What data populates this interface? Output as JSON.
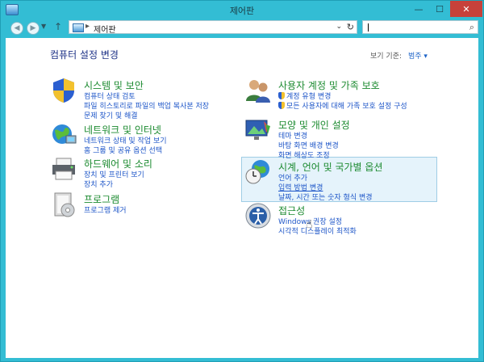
{
  "window": {
    "title": "제어판"
  },
  "navbar": {
    "breadcrumb": "제어판",
    "separator": "▸",
    "search_placeholder": ""
  },
  "header": {
    "page_title": "컴퓨터 설정 변경",
    "view_by_label": "보기 기준:",
    "view_by_value": "범주 ▾"
  },
  "categories": [
    {
      "id": "system",
      "title": "시스템 및 보안",
      "links": [
        "컴퓨터 상태 검토",
        "파일 히스토리로 파일의 백업 복사본 저장",
        "문제 찾기 및 해결"
      ],
      "icon": "shield-icon"
    },
    {
      "id": "network",
      "title": "네트워크 및 인터넷",
      "links": [
        "네트워크 상태 및 작업 보기",
        "홈 그룹 및 공유 옵션 선택"
      ],
      "icon": "globe-network-icon"
    },
    {
      "id": "hardware",
      "title": "하드웨어 및 소리",
      "links": [
        "장치 및 프린터 보기",
        "장치 추가"
      ],
      "icon": "printer-icon"
    },
    {
      "id": "programs",
      "title": "프로그램",
      "links": [
        "프로그램 제거"
      ],
      "icon": "programs-icon"
    },
    {
      "id": "users",
      "title": "사용자 계정 및 가족 보호",
      "links": [
        "계정 유형 변경",
        "모든 사용자에 대해 가족 보호 설정 구성"
      ],
      "icon": "users-icon"
    },
    {
      "id": "appearance",
      "title": "모양 및 개인 설정",
      "links": [
        "테마 변경",
        "바탕 화면 배경 변경",
        "화면 해상도 조정"
      ],
      "icon": "monitor-icon"
    },
    {
      "id": "clock",
      "title": "시계, 언어 및 국가별 옵션",
      "links": [
        "언어 추가",
        "입력 방법 변경",
        "날짜, 시간 또는 숫자 형식 변경"
      ],
      "icon": "clock-globe-icon"
    },
    {
      "id": "ease",
      "title": "접근성",
      "links": [
        "Windows 권장 설정",
        "시각적 디스플레이 최적화"
      ],
      "icon": "ease-of-access-icon"
    }
  ]
}
